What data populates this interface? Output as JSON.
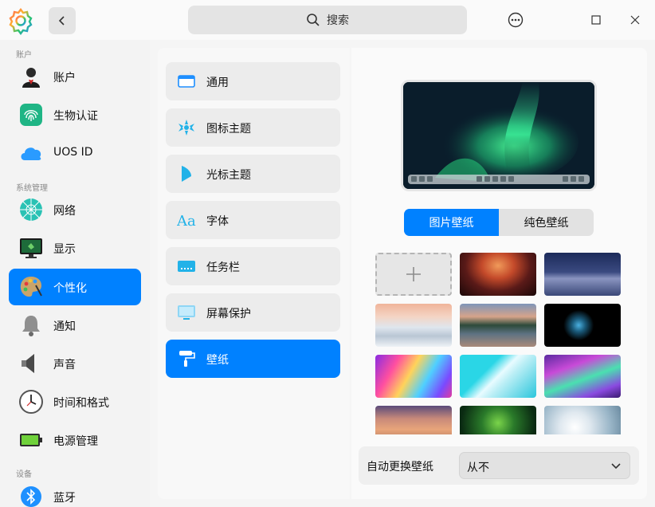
{
  "titlebar": {
    "search_placeholder": "搜索"
  },
  "sidebar": {
    "groups": [
      {
        "label": "账户"
      },
      {
        "label": "系统管理"
      },
      {
        "label": "设备"
      }
    ],
    "items": [
      {
        "label": "账户",
        "icon": "user-account-icon"
      },
      {
        "label": "生物认证",
        "icon": "fingerprint-icon"
      },
      {
        "label": "UOS ID",
        "icon": "cloud-icon"
      },
      {
        "label": "网络",
        "icon": "network-icon"
      },
      {
        "label": "显示",
        "icon": "display-icon"
      },
      {
        "label": "个性化",
        "icon": "personalization-palette-icon",
        "active": true
      },
      {
        "label": "通知",
        "icon": "bell-icon"
      },
      {
        "label": "声音",
        "icon": "speaker-icon"
      },
      {
        "label": "时间和格式",
        "icon": "clock-icon"
      },
      {
        "label": "电源管理",
        "icon": "battery-icon"
      },
      {
        "label": "蓝牙",
        "icon": "bluetooth-icon"
      }
    ]
  },
  "submenu": {
    "items": [
      {
        "label": "通用",
        "icon": "window-icon"
      },
      {
        "label": "图标主题",
        "icon": "icon-theme-icon"
      },
      {
        "label": "光标主题",
        "icon": "cursor-icon"
      },
      {
        "label": "字体",
        "icon": "font-icon"
      },
      {
        "label": "任务栏",
        "icon": "taskbar-icon"
      },
      {
        "label": "屏幕保护",
        "icon": "screensaver-icon"
      },
      {
        "label": "壁纸",
        "icon": "wallpaper-roller-icon",
        "active": true
      }
    ]
  },
  "wallpaper": {
    "tabs": [
      {
        "label": "图片壁纸",
        "active": true
      },
      {
        "label": "纯色壁纸",
        "active": false
      }
    ],
    "auto_change_label": "自动更换壁纸",
    "auto_change_value": "从不"
  },
  "colors": {
    "accent": "#0081ff",
    "sidebar_bg": "#f3f3f3",
    "panel_bg": "#fafafa"
  }
}
